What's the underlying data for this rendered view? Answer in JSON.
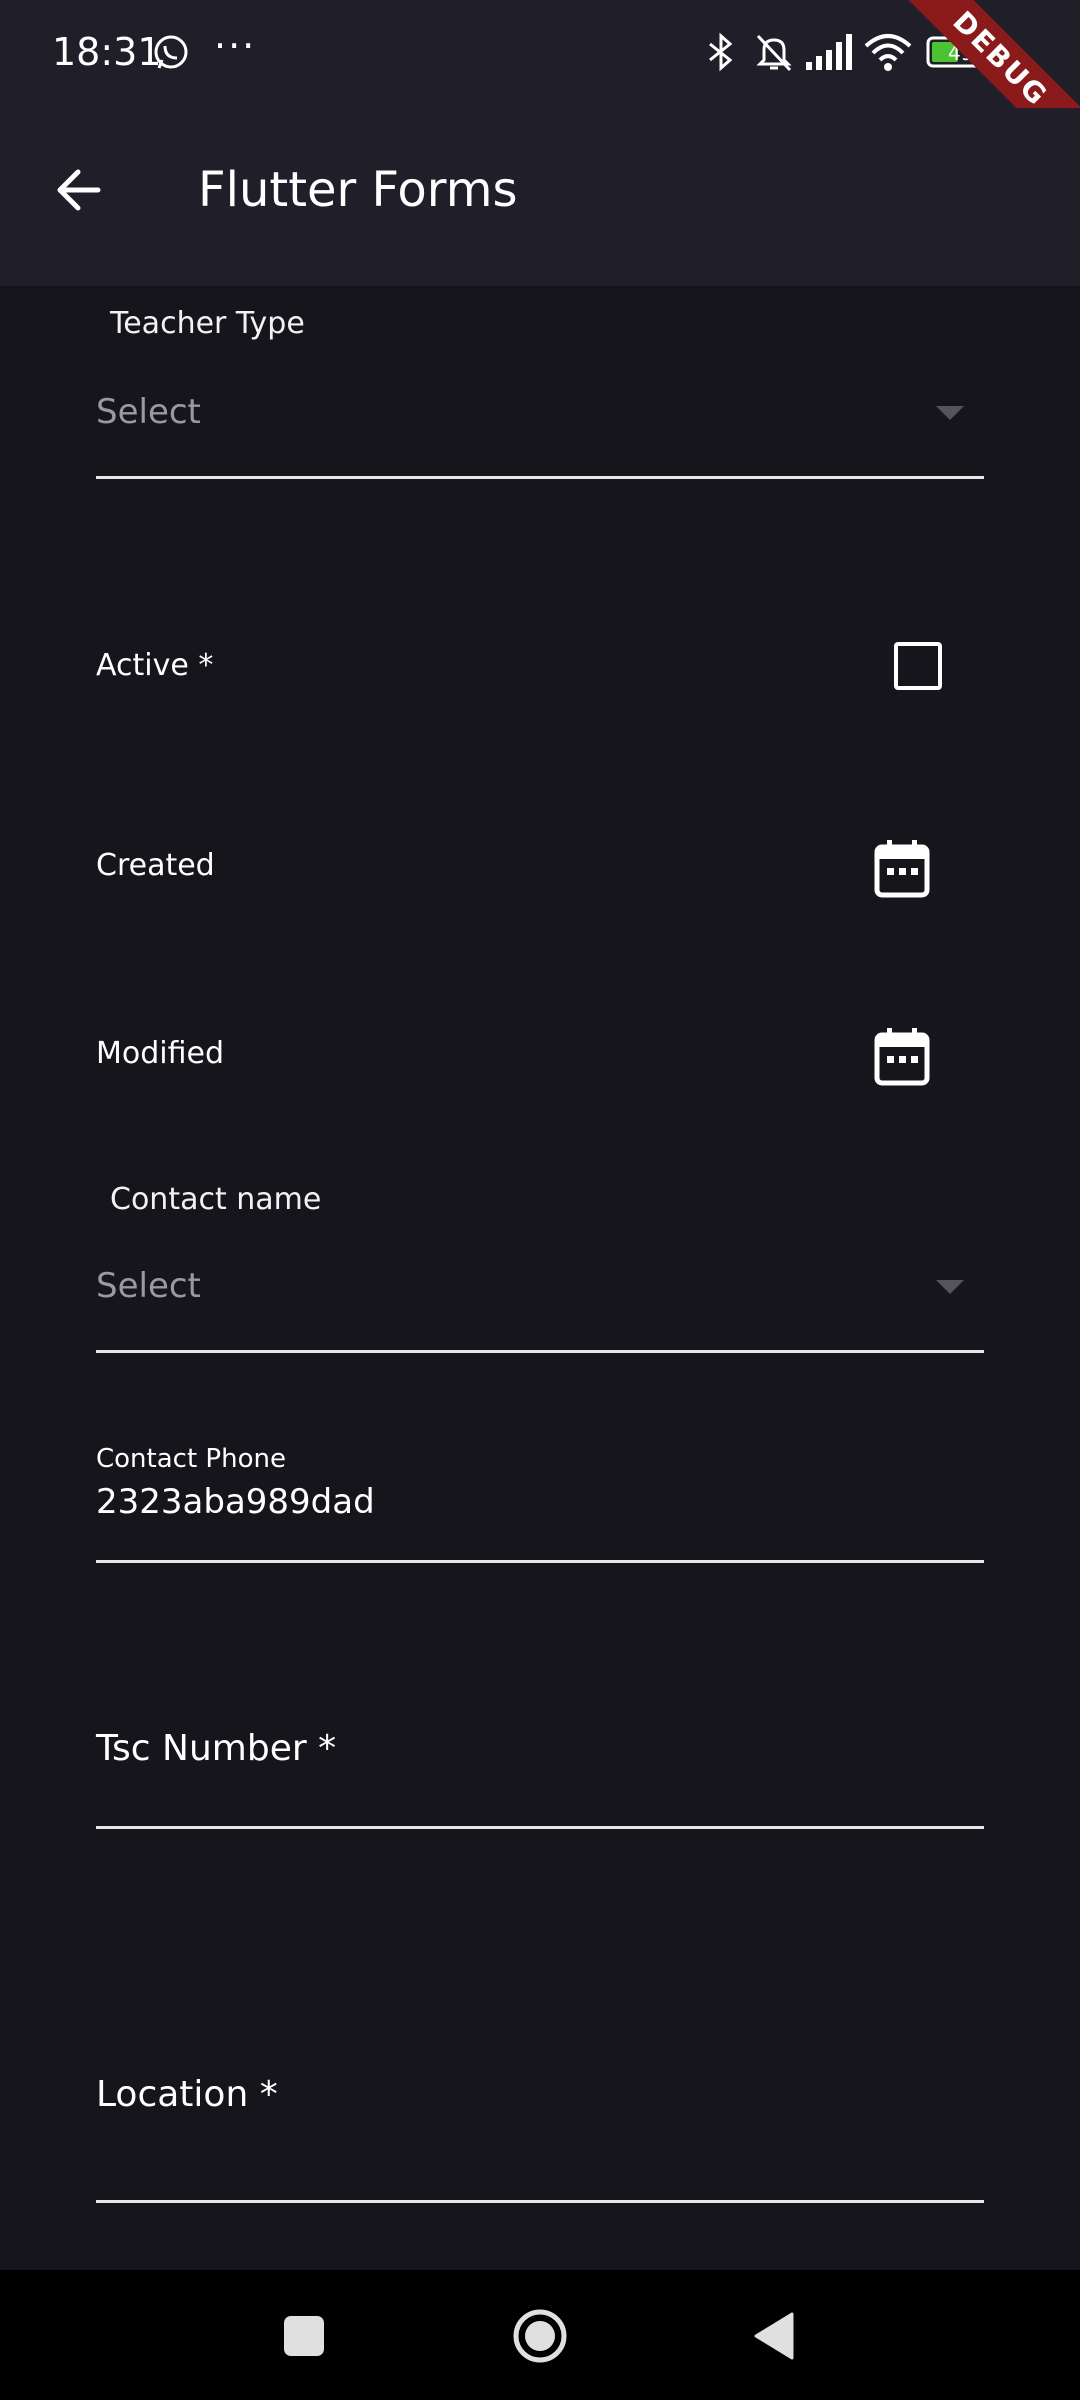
{
  "status_bar": {
    "time": "18:31",
    "more_indicator": "···",
    "battery_level": "49",
    "icons": [
      "whatsapp-icon",
      "bluetooth-icon",
      "mute-bell-icon",
      "signal-icon",
      "wifi-icon",
      "battery-icon"
    ]
  },
  "debug_banner": "DEBUG",
  "app_bar": {
    "title": "Flutter Forms",
    "back_icon": "arrow-left-icon"
  },
  "form": {
    "teacher_type": {
      "label": "Teacher Type",
      "placeholder": "Select"
    },
    "active": {
      "label": "Active *",
      "checked": false
    },
    "created": {
      "label": "Created",
      "icon": "calendar-icon"
    },
    "modified": {
      "label": "Modified",
      "icon": "calendar-icon"
    },
    "contact_name": {
      "label": "Contact name",
      "placeholder": "Select"
    },
    "contact_phone": {
      "label": "Contact Phone",
      "value": "2323aba989dad"
    },
    "tsc_number": {
      "label": "Tsc Number *",
      "value": ""
    },
    "location": {
      "label": "Location *",
      "value": ""
    }
  },
  "nav_bar": {
    "buttons": [
      "recent-apps-icon",
      "home-icon",
      "back-triangle-icon"
    ]
  },
  "colors": {
    "background": "#16151b",
    "app_bar": "#201f29",
    "debug_ribbon": "#8b1a1a",
    "placeholder": "#9a99a2"
  }
}
